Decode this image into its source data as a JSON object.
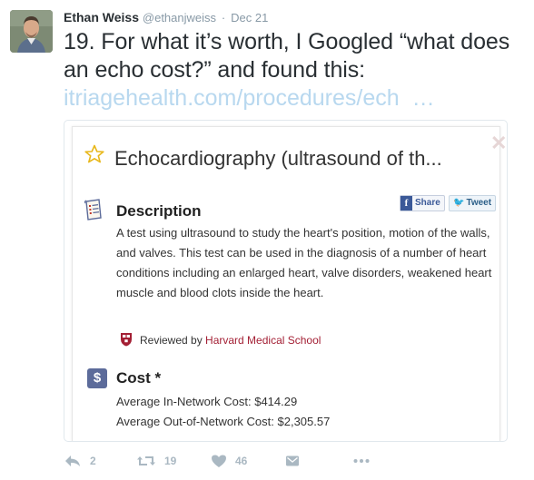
{
  "tweet": {
    "author_name": "Ethan Weiss",
    "author_handle": "@ethanjweiss",
    "separator": "·",
    "date": "Dec 21",
    "text": "19. For what it’s worth, I Googled “what does an echo cost?” and found this:",
    "link_text": "itriagehealth.com/procedures/ech",
    "link_ellipsis": "…"
  },
  "card": {
    "title": "Echocardiography (ultrasound of th...",
    "close_glyph": "✕",
    "description": {
      "heading": "Description",
      "share_label": "Share",
      "share_icon_glyph": "f",
      "tweet_label": "Tweet",
      "tweet_icon_glyph": "🐦",
      "body": "A test using ultrasound to study the heart's position, motion of the walls, and valves. This test can be used in the diagnosis of a number of heart conditions including an enlarged heart, valve disorders, weakened heart muscle and blood clots inside the heart.",
      "reviewed_prefix": "Reviewed by",
      "reviewed_by": "Harvard Medical School"
    },
    "cost": {
      "icon_glyph": "$",
      "heading": "Cost *",
      "in_network": "Average In-Network Cost: $414.29",
      "out_network": "Average Out-of-Network Cost: $2,305.57"
    }
  },
  "actions": {
    "reply_count": "2",
    "retweet_count": "19",
    "like_count": "46"
  },
  "colors": {
    "link": "#b8d8ef",
    "muted": "#8899a6",
    "action_gray": "#aab8c2",
    "harvard_crimson": "#a31f34",
    "cost_icon": "#5c6b9a",
    "star": "#e8b71a"
  },
  "icons": {
    "avatar": "avatar-photo",
    "star": "star-outline-icon",
    "description": "document-list-icon",
    "harvard": "harvard-shield-icon",
    "reply": "reply-arrow-icon",
    "retweet": "retweet-icon",
    "like": "heart-icon",
    "share": "envelope-icon",
    "more": "more-dots-icon"
  }
}
